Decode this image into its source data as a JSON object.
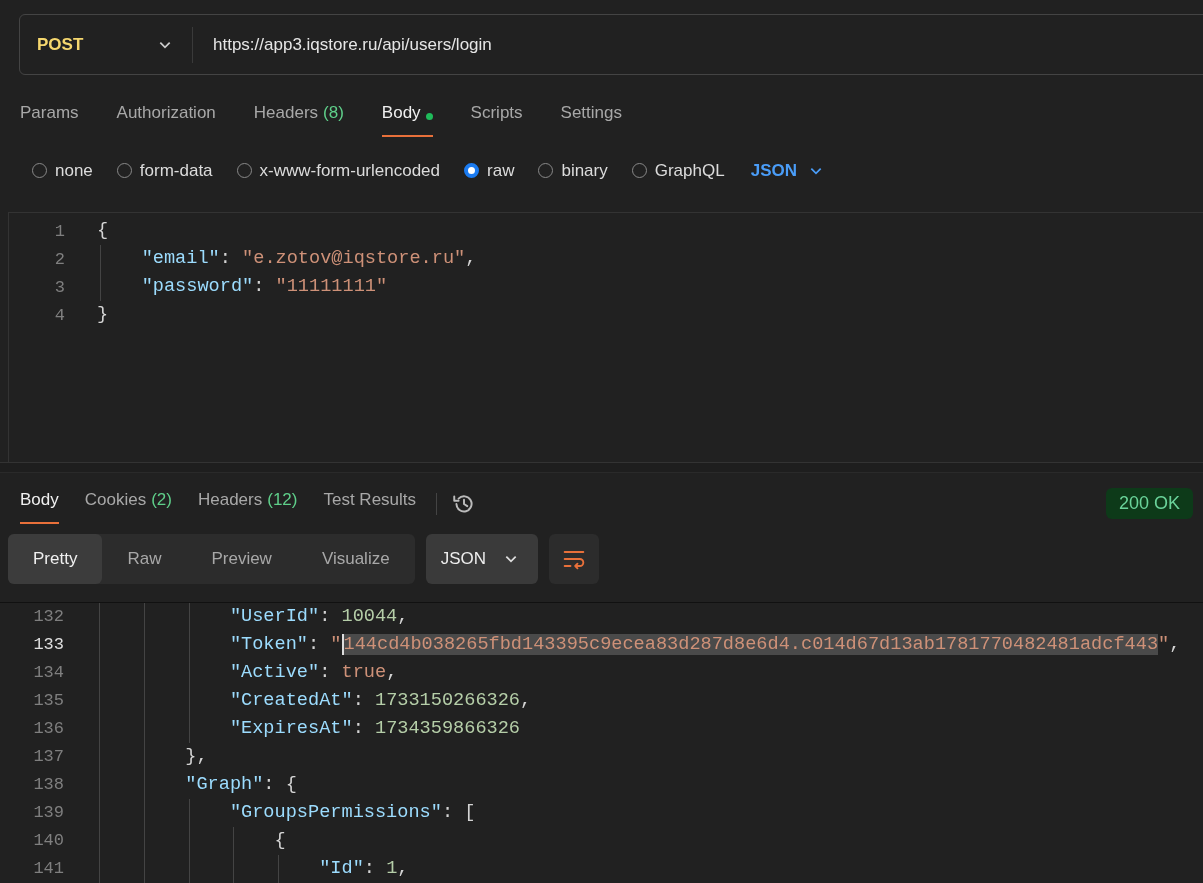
{
  "request": {
    "method": "POST",
    "url": "https://app3.iqstore.ru/api/users/login"
  },
  "request_tabs": [
    {
      "label": "Params",
      "selected": false
    },
    {
      "label": "Authorization",
      "selected": false
    },
    {
      "label": "Headers",
      "count": "(8)",
      "selected": false
    },
    {
      "label": "Body",
      "selected": true,
      "modified": true
    },
    {
      "label": "Scripts",
      "selected": false
    },
    {
      "label": "Settings",
      "selected": false
    }
  ],
  "body_types": [
    {
      "label": "none",
      "selected": false
    },
    {
      "label": "form-data",
      "selected": false
    },
    {
      "label": "x-www-form-urlencoded",
      "selected": false
    },
    {
      "label": "raw",
      "selected": true
    },
    {
      "label": "binary",
      "selected": false
    },
    {
      "label": "GraphQL",
      "selected": false
    }
  ],
  "body_format": "JSON",
  "request_editor": {
    "lines": [
      {
        "number": "1",
        "current": false,
        "tokens": [
          {
            "kind": "punct",
            "text": "{"
          }
        ],
        "children": [
          {
            "number": "2",
            "current": false,
            "tokens": [
              {
                "kind": "key",
                "text": "\"email\""
              },
              {
                "kind": "punct",
                "text": ": "
              },
              {
                "kind": "string",
                "text": "\"e.zotov@iqstore.ru\""
              },
              {
                "kind": "punct",
                "text": ","
              }
            ]
          },
          {
            "number": "3",
            "current": false,
            "tokens": [
              {
                "kind": "key",
                "text": "\"password\""
              },
              {
                "kind": "punct",
                "text": ": "
              },
              {
                "kind": "string",
                "text": "\"11111111\""
              }
            ]
          }
        ]
      },
      {
        "number": "4",
        "current": false,
        "tokens": [
          {
            "kind": "punct",
            "text": "}"
          }
        ]
      }
    ]
  },
  "response_tabs": [
    {
      "label": "Body",
      "selected": true
    },
    {
      "label": "Cookies",
      "count": "(2)",
      "selected": false
    },
    {
      "label": "Headers",
      "count": "(12)",
      "selected": false
    },
    {
      "label": "Test Results",
      "selected": false
    }
  ],
  "status": "200 OK",
  "view_modes": [
    {
      "label": "Pretty",
      "selected": true
    },
    {
      "label": "Raw",
      "selected": false
    },
    {
      "label": "Preview",
      "selected": false
    },
    {
      "label": "Visualize",
      "selected": false
    }
  ],
  "response_format": "JSON",
  "response_editor": {
    "lines": [
      {
        "children": [
          {
            "children": [
              {
                "children": [
                  {
                    "number": "132",
                    "current": false,
                    "tokens": [
                      {
                        "kind": "key",
                        "text": "\"UserId\""
                      },
                      {
                        "kind": "punct",
                        "text": ": "
                      },
                      {
                        "kind": "number",
                        "text": "10044"
                      },
                      {
                        "kind": "punct",
                        "text": ","
                      }
                    ]
                  },
                  {
                    "number": "133",
                    "current": true,
                    "tokens": [
                      {
                        "kind": "key",
                        "text": "\"Token\""
                      },
                      {
                        "kind": "punct",
                        "text": ": "
                      },
                      {
                        "kind": "string",
                        "text": "\""
                      },
                      {
                        "kind": "string",
                        "text": "144cd4b038265fbd143395c9ecea83d287d8e6d4.c014d67d13ab1781770482481adcf443",
                        "selected": true
                      },
                      {
                        "kind": "string",
                        "text": "\""
                      },
                      {
                        "kind": "punct",
                        "text": ","
                      }
                    ]
                  },
                  {
                    "number": "134",
                    "current": false,
                    "tokens": [
                      {
                        "kind": "key",
                        "text": "\"Active\""
                      },
                      {
                        "kind": "punct",
                        "text": ": "
                      },
                      {
                        "kind": "boolean",
                        "text": "true"
                      },
                      {
                        "kind": "punct",
                        "text": ","
                      }
                    ]
                  },
                  {
                    "number": "135",
                    "current": false,
                    "tokens": [
                      {
                        "kind": "key",
                        "text": "\"CreatedAt\""
                      },
                      {
                        "kind": "punct",
                        "text": ": "
                      },
                      {
                        "kind": "number",
                        "text": "1733150266326"
                      },
                      {
                        "kind": "punct",
                        "text": ","
                      }
                    ]
                  },
                  {
                    "number": "136",
                    "current": false,
                    "tokens": [
                      {
                        "kind": "key",
                        "text": "\"ExpiresAt\""
                      },
                      {
                        "kind": "punct",
                        "text": ": "
                      },
                      {
                        "kind": "number",
                        "text": "1734359866326"
                      }
                    ]
                  }
                ]
              },
              {
                "number": "137",
                "current": false,
                "tokens": [
                  {
                    "kind": "punct",
                    "text": "},"
                  }
                ]
              },
              {
                "number": "138",
                "current": false,
                "tokens": [
                  {
                    "kind": "key",
                    "text": "\"Graph\""
                  },
                  {
                    "kind": "punct",
                    "text": ": {"
                  }
                ],
                "children": [
                  {
                    "number": "139",
                    "current": false,
                    "tokens": [
                      {
                        "kind": "key",
                        "text": "\"GroupsPermissions\""
                      },
                      {
                        "kind": "punct",
                        "text": ": ["
                      }
                    ],
                    "children": [
                      {
                        "number": "140",
                        "current": false,
                        "tokens": [
                          {
                            "kind": "punct",
                            "text": "{"
                          }
                        ],
                        "children": [
                          {
                            "number": "141",
                            "current": false,
                            "tokens": [
                              {
                                "kind": "key",
                                "text": "\"Id\""
                              },
                              {
                                "kind": "punct",
                                "text": ": "
                              },
                              {
                                "kind": "number",
                                "text": "1"
                              },
                              {
                                "kind": "punct",
                                "text": ","
                              }
                            ]
                          }
                        ]
                      }
                    ]
                  }
                ]
              }
            ]
          }
        ]
      }
    ]
  }
}
